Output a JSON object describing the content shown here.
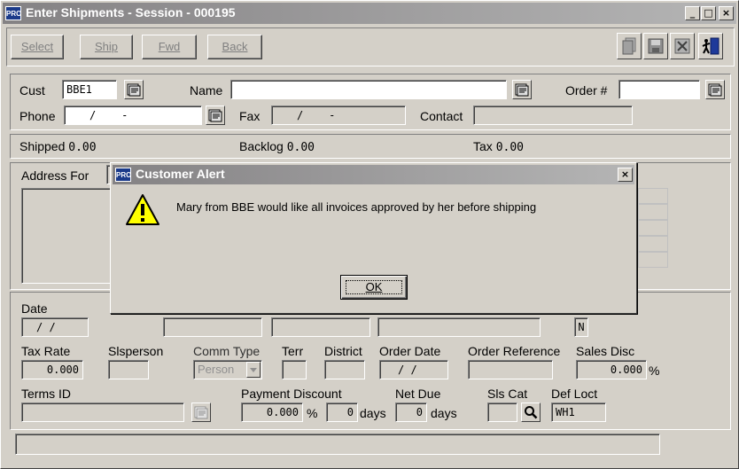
{
  "window": {
    "title": "Enter Shipments - Session - 000195",
    "app_badge": "PRO",
    "minimize": "_",
    "maximize": "□",
    "close": "×"
  },
  "toolbar": {
    "select_label": "Select",
    "ship_label": "Ship",
    "fwd_label": "Fwd",
    "back_label": "Back"
  },
  "header": {
    "cust_label": "Cust",
    "cust_value": "BBE1",
    "name_label": "Name",
    "name_value": "",
    "order_label": "Order #",
    "order_value": "",
    "phone_label": "Phone",
    "phone_value": "/    -",
    "fax_label": "Fax",
    "fax_value": "/    -",
    "contact_label": "Contact",
    "contact_value": ""
  },
  "totals": {
    "shipped_label": "Shipped",
    "shipped_value": "0.00",
    "backlog_label": "Backlog",
    "backlog_value": "0.00",
    "tax_label": "Tax",
    "tax_value": "0.00"
  },
  "address": {
    "label": "Address For"
  },
  "details": {
    "date_label": "Date",
    "date_value": "/ /",
    "flag_value": "N",
    "tax_rate_label": "Tax Rate",
    "tax_rate_value": "0.000",
    "slsperson_label": "Slsperson",
    "slsperson_value": "",
    "comm_type_label": "Comm Type",
    "comm_type_value": "Person",
    "terr_label": "Terr",
    "district_label": "District",
    "order_date_label": "Order Date",
    "order_date_value": "/ /",
    "order_ref_label": "Order Reference",
    "sales_disc_label": "Sales Disc",
    "sales_disc_value": "0.000",
    "percent": "%",
    "terms_label": "Terms ID",
    "terms_value": "",
    "payment_discount_label": "Payment Discount",
    "payment_discount_value": "0.000",
    "payment_days_value": "0",
    "days_label": "days",
    "net_due_label": "Net Due",
    "net_due_value": "0",
    "sls_cat_label": "Sls Cat",
    "def_loct_label": "Def Loct",
    "def_loct_value": "WH1"
  },
  "alert": {
    "title": "Customer Alert",
    "close": "×",
    "message": "Mary from BBE would like all invoices approved by her before shipping",
    "ok_label": "OK"
  },
  "icons": [
    "pages-icon",
    "save-icon",
    "delete-icon",
    "exit-door-icon",
    "lookup-icon",
    "magnifier-icon",
    "warning-icon"
  ]
}
